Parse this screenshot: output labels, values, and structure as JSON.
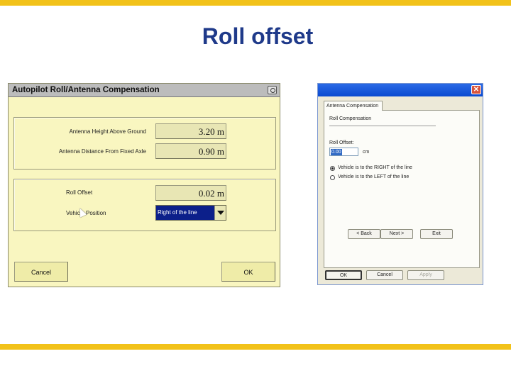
{
  "slide": {
    "title": "Roll offset",
    "watermark": ""
  },
  "left_dialog": {
    "title": "Autopilot Roll/Antenna Compensation",
    "fields": [
      {
        "label": "Antenna Height Above Ground",
        "value": "3.20 m"
      },
      {
        "label": "Antenna Distance From Fixed Axle",
        "value": "0.90 m"
      },
      {
        "label": "Roll Offset",
        "value": "0.02 m"
      }
    ],
    "vehicle_position": {
      "label": "Vehicle Position",
      "selected": "Right of the line"
    },
    "buttons": {
      "cancel": "Cancel",
      "ok": "OK"
    }
  },
  "right_dialog": {
    "close_label": "✕",
    "tab": "Antenna Compensation",
    "section": "Roll Compensation",
    "roll_offset_label": "Roll Offset:",
    "roll_offset_value": "0.00",
    "unit": "cm",
    "radio_options": [
      {
        "label": "Vehicle is to the RIGHT of the line",
        "checked": true
      },
      {
        "label": "Vehicle is to the LEFT of the line",
        "checked": false
      }
    ],
    "wizard_buttons": {
      "back": "< Back",
      "next": "Next >",
      "exit": "Exit"
    },
    "buttons": {
      "ok": "OK",
      "cancel": "Cancel",
      "apply": "Apply"
    }
  },
  "colors": {
    "accent_bar": "#f2c21a",
    "title": "#1f3a8a",
    "dialog_bg": "#f9f6c0",
    "selection": "#0c1f8a"
  }
}
